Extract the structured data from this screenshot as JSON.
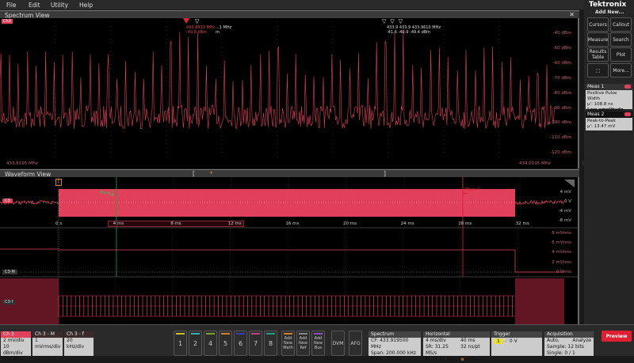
{
  "menu": [
    "File",
    "Edit",
    "Utility",
    "Help"
  ],
  "spectrum": {
    "title": "Spectrum View",
    "channel_badge": "Ch3",
    "y_labels": [
      "-40 dBm",
      "-50 dBm",
      "-60 dBm",
      "-70 dBm",
      "-80 dBm",
      "-90 dBm",
      "-100 dBm",
      "-110 dBm",
      "-120 dBm"
    ],
    "freq_start": "433.8195 MHz",
    "freq_end": "434.0195 MHz",
    "marker_ref": {
      "freq": "433.8833 MHz",
      "level": "-40.8 dBm",
      "label": "R"
    },
    "marker_2": {
      "freq": "...1 MHz",
      "level": "m"
    },
    "marker_right": {
      "freqs": "433.9 433.9 433.9610 MHz",
      "levels": "-41.6 -40.9 -49.4 dBm"
    },
    "trace_color": "#e0405a"
  },
  "waveform": {
    "title": "Waveform View",
    "trigger_label": "T",
    "ch3_label": "C3",
    "ch3m_label": "C3-M",
    "ch3f_label": "C3-f",
    "meas_label_1": "Meas 2",
    "meas_label_2": "Meas 2",
    "time_labels": [
      "0 s",
      "4 ms",
      "8 ms",
      "12 ms",
      "16 ms",
      "20 ms",
      "24 ms",
      "28 ms",
      "32 ms"
    ],
    "ch3_y_labels": [
      "4 mV",
      "0 V",
      "-4 mV",
      "-8 mV"
    ],
    "ch3m_y_labels": [
      "8 mVrms",
      "6 mVrms",
      "4 mVrms",
      "2 mVrms",
      "0 Vrms"
    ]
  },
  "right_panel": {
    "brand": "Tektronix",
    "add_new": "Add New...",
    "buttons": [
      "Cursors",
      "Callout",
      "Measure",
      "Search",
      "Results Table",
      "Plot",
      "",
      "More..."
    ],
    "meas1": {
      "title": "Meas 1",
      "name": "Positive Pulse Width",
      "value": "µ': 108.8 ns",
      "note": "Low amplitude"
    },
    "meas2": {
      "title": "Meas 2",
      "name": "Peak-to-Peak",
      "value": "µ': 13.47 mV"
    }
  },
  "bottom": {
    "ch3": {
      "title": "Ch 3",
      "lines": [
        "2 mV/div",
        "10 dBm/div",
        "350 MHz"
      ]
    },
    "ch3m": {
      "title": "Ch 3 - M",
      "lines": [
        "1 mVrms/div"
      ]
    },
    "ch3f": {
      "title": "Ch 3 - f",
      "lines": [
        "20 kHz/div"
      ]
    },
    "channels": [
      {
        "n": "1",
        "c": "#c8c030"
      },
      {
        "n": "2",
        "c": "#30b0b0"
      },
      {
        "n": "4",
        "c": "#80a030"
      },
      {
        "n": "5",
        "c": "#d08030"
      },
      {
        "n": "6",
        "c": "#3040c0"
      },
      {
        "n": "7",
        "c": "#c04080"
      },
      {
        "n": "8",
        "c": "#20a080"
      }
    ],
    "add_math": "Add New Math",
    "add_ref": "Add New Ref",
    "add_bus": "Add New Bus",
    "dvm": "DVM",
    "afg": "AFG",
    "spectrum": {
      "title": "Spectrum",
      "cf": "CF: 433.919500 MHz",
      "span": "Span: 200.000 kHz",
      "rbw": "RBW: 200 Hz"
    },
    "horizontal": {
      "title": "Horizontal",
      "scale": "4 ms/div",
      "dur": "40 ms",
      "sr": "SR: 31.25 MS/s",
      "pt": "32 ns/pt",
      "rl": "RL: 1.25 Mpts",
      "pos": "10%"
    },
    "trigger": {
      "title": "Trigger",
      "source": "1",
      "level": "0 V"
    },
    "acquisition": {
      "title": "Acquisition",
      "mode": "Auto,",
      "analyze": "Analyze",
      "sample": "Sample: 12 bits",
      "single": "Single: 0 / 1"
    },
    "preview": "Preview"
  }
}
